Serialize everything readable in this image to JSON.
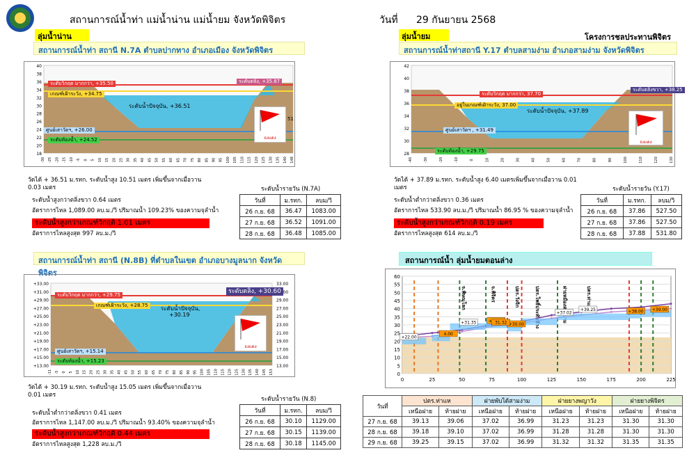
{
  "header": {
    "title": "สถานการณ์น้ำท่า แม่น้ำน่าน แม่น้ำยม จังหวัดพิจิตร",
    "date_label": "วันที่",
    "date": "29 กันยายน 2568",
    "logo_text": "กรมชลประทาน"
  },
  "left_basin": "ลุ่มน้ำน่าน",
  "right_basin": "ลุ่มน้ำยม",
  "project": "โครงการชลประทานพิจิตร",
  "flag_caption": "ธงแดง",
  "n7a": {
    "title": "สถานการณ์น้ำท่า สถานี  N.7A  ตำบลปากทาง  อำเภอเมือง จังหวัดพิจิตร",
    "labels": {
      "critical": "ระดับวิกฤต มากกว่า, +35.50",
      "bank": "ระดับตลิ่ง, +35.87",
      "watch": "เกณฑ์เฝ้าระวัง, +34.75",
      "current": "ระดับน้ำปัจจุบัน, +36.51",
      "bed": "ศูนย์เสาวัดฯ, +26.00",
      "low": "ระดับท้องน้ำ, +24.52",
      "side": "51"
    },
    "y_ticks": [
      "40",
      "38",
      "36",
      "34",
      "32",
      "30",
      "28",
      "26",
      "24",
      "22",
      "20",
      "18"
    ],
    "x_ticks": [
      "-30",
      "-25",
      "-20",
      "-15",
      "-10",
      "-5",
      "0",
      "5",
      "10",
      "15",
      "20",
      "25",
      "30",
      "35",
      "40",
      "45",
      "50",
      "55",
      "60",
      "65",
      "70",
      "75",
      "80",
      "85",
      "90",
      "95",
      "100",
      "105",
      "110",
      "115",
      "120",
      "125",
      "130",
      "135",
      "140",
      "148"
    ],
    "desc1": "วัดได้ + 36.51 ม.รทก. ระดับน้ำสูง 10.51 เมตร เพิ่มขึ้นจากเมื่อวาน",
    "desc2": "0.03 เมตร",
    "line_bank": "ระดับน้ำสูงกว่าตลิ่งขวา 0.64  เมตร",
    "line_flow": "อัตราการไหล 1,089.00 ลบ.ม./วิ ปริมาณน้ำ 109.23%  ของความจุลำน้ำ",
    "line_crit": "ระดับน้ำสูงกว่าเกณฑ์วิกฤติ  1.01  เมตร",
    "line_max": "อัตราการไหลสูงสุด 997 ลบ.ม./วิ",
    "table_title": "ระดับน้ำรายวัน (N.7A)",
    "table_head": [
      "วันที่",
      "ม.รทก.",
      "ลบม/วิ"
    ],
    "table_rows": [
      [
        "26 ก.ย. 68",
        "36.47",
        "1083.00"
      ],
      [
        "27 ก.ย. 68",
        "36.52",
        "1091.00"
      ],
      [
        "28 ก.ย. 68",
        "36.48",
        "1085.00"
      ]
    ]
  },
  "y17": {
    "title": "สถานการณ์น้ำท่าสถานี Y.17  ตำบลสามง่าม อำเภอสามง่าม จังหวัดพิจิตร",
    "labels": {
      "critical": "ระดับวิกฤต มากกว่า, 37.70",
      "bank": "ระดับตลิ่งขวา, +38.25",
      "watch": "อยู่ในเกณฑ์เฝ้าระวัง, 37.00",
      "current": "ระดับน้ำปัจจุบัน, +37.89",
      "bed": "ศูนย์เสาวัดฯ , +31.49",
      "low": "ระดับท้องน้ำ, +29.75"
    },
    "y_ticks": [
      "42",
      "40",
      "38",
      "36",
      "34",
      "32",
      "30",
      "28"
    ],
    "x_ticks": [
      "-40",
      "-30",
      "-20",
      "-10",
      "0",
      "10",
      "20",
      "30",
      "40",
      "50",
      "60",
      "70",
      "80",
      "90",
      "100",
      "110",
      "120",
      "130"
    ],
    "desc1": "วัดได้ + 37.89 ม.รทก. ระดับน้ำสูง  6.40 เมตรเพิ่มขึ้นจากเมื่อวาน 0.01",
    "desc2": "เมตร",
    "line_bank": "ระดับน้ำต่ำกว่าตลิ่งขวา 0.36  เมตร",
    "line_flow": "อัตราการไหล 533.90 ลบ.ม./วิ ปริมาณน้ำ 86.95 % ของความจุลำน้ำ",
    "line_crit": "ระดับน้ำสูงกว่าเกณฑ์วิกฤติ  0.19  เมตร",
    "line_max": "อัตราการไหลสูงสุด 614 ลบ.ม./วิ",
    "table_title": "ระดับน้ำรายวัน (Y.17)",
    "table_head": [
      "วันที่",
      "ม.รทก.",
      "ลบม/วิ"
    ],
    "table_rows": [
      [
        "26 ก.ย. 68",
        "37.86",
        "527.50"
      ],
      [
        "27 ก.ย. 68",
        "37.86",
        "527.50"
      ],
      [
        "28 ก.ย. 68",
        "37.88",
        "531.80"
      ]
    ]
  },
  "n8b": {
    "title": "สถานการณ์น้ำท่า สถานี (N.8B)  ที่ตำบลในเขต อำเภอบางมูลนาก จังหวัดพิจิตร",
    "labels": {
      "critical": "ระดับวิกฤต มากกว่า, +29.75",
      "bank": "ระดับตลิ่ง, +30.60",
      "watch": "เกณฑ์เฝ้าระวัง, +28.75",
      "current": "ระดับน้ำปัจจุบัน,",
      "current2": "+30.19",
      "bed": "ศูนย์เสาวัดฯ, +15.14",
      "low": "ระดับท้องน้ำ, +15.23"
    },
    "y_ticks": [
      "+33.00",
      "+31.00",
      "+29.00",
      "+27.00",
      "+25.00",
      "+23.00",
      "+21.00",
      "+19.00",
      "+17.00",
      "+15.00",
      "+13.00"
    ],
    "y_ticks_r": [
      "33.00",
      "31.00",
      "29.00",
      "27.00",
      "25.00",
      "23.00",
      "21.00",
      "19.00",
      "17.00",
      "15.00",
      "13.00"
    ],
    "x_ticks": [
      "-11",
      "-5",
      "0",
      "5",
      "10",
      "15",
      "20",
      "25",
      "30",
      "35",
      "40",
      "45",
      "50",
      "55",
      "60",
      "65",
      "70",
      "75",
      "80",
      "85",
      "90",
      "95",
      "100",
      "105",
      "110",
      "115",
      "120",
      "125",
      "130",
      "135",
      "140",
      "145",
      "153"
    ],
    "desc1": "วัดได้ + 30.19 ม.รทก. ระดับน้ำสูง 15.05 เมตร เพิ่มขึ้นจากเมื่อวาน",
    "desc2": "0.01 เมตร",
    "line_bank": "ระดับน้ำต่ำกว่าตลิ่งขวา 0.41  เมตร",
    "line_flow": "อัตราการไหล 1,147.00 ลบ.ม./วิ ปริมาณน้ำ 93.40%  ของความจุลำน้ำ",
    "line_crit": "ระดับน้ำสูงกว่าเกณฑ์วิกฤติ  0.44  เมตร",
    "line_max": "อัตราการไหลสูงสุด 1,228 ลบ.ม./วิ",
    "table_title": "ระดับน้ำรายวัน (N.8)",
    "table_head": [
      "วันที่",
      "ม.รทก.",
      "ลบม/วิ"
    ],
    "table_rows": [
      [
        "26 ก.ย. 68",
        "30.10",
        "1129.00"
      ],
      [
        "27 ก.ย. 68",
        "30.15",
        "1139.00"
      ],
      [
        "28 ก.ย. 68",
        "30.18",
        "1145.00"
      ]
    ]
  },
  "lower_yom": {
    "title": "สถานการณ์น้ำ ลุ่มน้ำยมตอนล่าง",
    "y_ticks": [
      "60",
      "55",
      "50",
      "45",
      "40",
      "35",
      "30",
      "25",
      "20",
      "15",
      "10",
      "5",
      "0"
    ],
    "x_ticks": [
      "0",
      "25",
      "50",
      "75",
      "100",
      "125",
      "150",
      "175",
      "200",
      "225"
    ],
    "annotations": [
      "จ.พิษณุโลก",
      "จ.พิจิตร",
      "ปตร.วังจิก",
      "ปตร.โพธิ์ประทับช้าง",
      "ฝายหมืองสามง่าม",
      "ปตร.ท่าแห"
    ],
    "markers": [
      "+22.00",
      "+31.35",
      "+37.02",
      "+39.25",
      "+39.00",
      "+38.00",
      "+30.00",
      "+31.32",
      "4.00",
      "31.32"
    ],
    "chart_data": {
      "type": "line",
      "x": [
        0,
        25,
        50,
        75,
        100,
        125,
        150,
        175,
        200,
        225
      ],
      "series": [
        {
          "values": [
            23,
            25,
            27,
            30,
            32,
            36,
            38,
            40,
            41,
            43
          ]
        },
        {
          "values": [
            22,
            23,
            26,
            29,
            31,
            34,
            36,
            38,
            39,
            40
          ]
        }
      ],
      "ylim": [
        0,
        60
      ]
    }
  },
  "bottom_table": {
    "date_head": "วันที่",
    "groups": [
      "ปตร.ท่าแห",
      "ฝายพับได้สามง่าม",
      "ฝายยางพญาวัง",
      "ฝายยางพิจิตร"
    ],
    "subs": [
      "เหนือฝาย",
      "ท้ายฝาย"
    ],
    "rows": [
      [
        "27 ก.ย. 68",
        "39.13",
        "39.06",
        "37.02",
        "36.99",
        "31.23",
        "31.23",
        "31.30",
        "31.30"
      ],
      [
        "28 ก.ย. 68",
        "39.18",
        "39.10",
        "37.02",
        "36.99",
        "31.28",
        "31.28",
        "31.30",
        "31.30"
      ],
      [
        "29 ก.ย. 68",
        "39.25",
        "39.15",
        "37.02",
        "36.99",
        "31.32",
        "31.32",
        "31.35",
        "31.35"
      ]
    ]
  }
}
